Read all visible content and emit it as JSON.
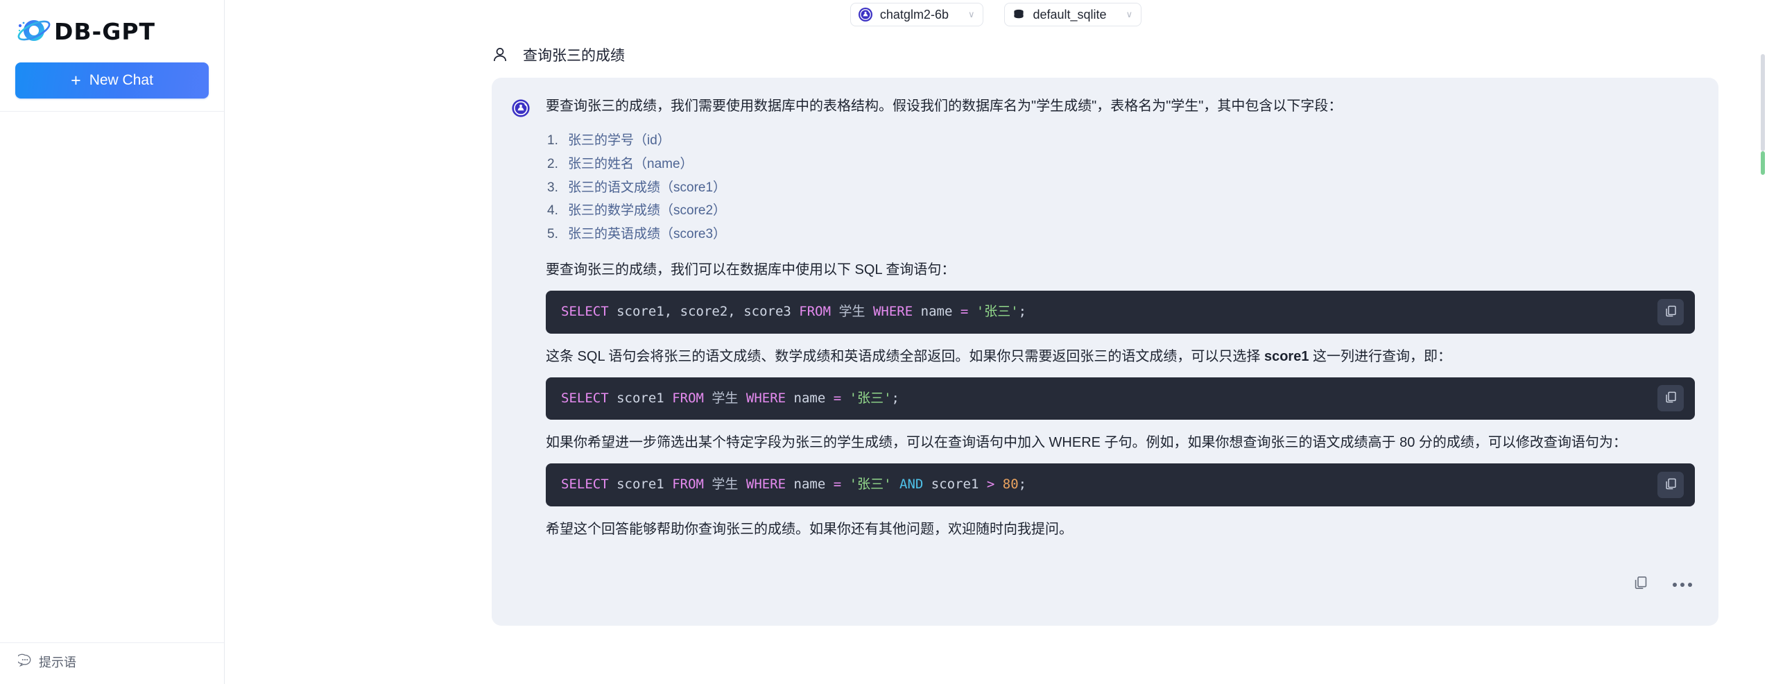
{
  "sidebar": {
    "brand_name": "DB-GPT",
    "brand_logo_icon": "planet-orbit-logo",
    "new_chat_label": "New Chat",
    "new_chat_plus": "+",
    "footer": {
      "prompt_label": "提示语",
      "prompt_icon": "chat-bubble-dots-icon"
    }
  },
  "topbar": {
    "model_selector": {
      "value": "chatglm2-6b",
      "icon": "model-badge-icon",
      "caret": "∨"
    },
    "db_selector": {
      "value": "default_sqlite",
      "icon": "database-icon",
      "caret": "∨"
    }
  },
  "conversation": {
    "user_message": {
      "icon": "user-person-icon",
      "text": "查询张三的成绩"
    },
    "assistant_message": {
      "avatar_icon": "assistant-badge-icon",
      "lead_paragraph": "要查询张三的成绩，我们需要使用数据库中的表格结构。假设我们的数据库名为\"学生成绩\"，表格名为\"学生\"，其中包含以下字段：",
      "fields": [
        "张三的学号（id）",
        "张三的姓名（name）",
        "张三的语文成绩（score1）",
        "张三的数学成绩（score2）",
        "张三的英语成绩（score3）"
      ],
      "paragraph_2": "要查询张三的成绩，我们可以在数据库中使用以下 SQL 查询语句：",
      "code_1": {
        "language": "sql",
        "text": "SELECT score1, score2, score3 FROM 学生 WHERE name = '张三';",
        "copy_icon": "copy-icon"
      },
      "paragraph_3_before": "这条 SQL 语句会将张三的语文成绩、数学成绩和英语成绩全部返回。如果你只需要返回张三的语文成绩，可以只选择 ",
      "paragraph_3_bold": "score1",
      "paragraph_3_after": " 这一列进行查询，即：",
      "code_2": {
        "language": "sql",
        "text": "SELECT score1 FROM 学生 WHERE name = '张三';",
        "copy_icon": "copy-icon"
      },
      "paragraph_4": "如果你希望进一步筛选出某个特定字段为张三的学生成绩，可以在查询语句中加入 WHERE 子句。例如，如果你想查询张三的语文成绩高于 80 分的成绩，可以修改查询语句为：",
      "code_3": {
        "language": "sql",
        "text": "SELECT score1 FROM 学生 WHERE name = '张三' AND score1 > 80;",
        "copy_icon": "copy-icon"
      },
      "paragraph_5": "希望这个回答能够帮助你查询张三的成绩。如果你还有其他问题，欢迎随时向我提问。",
      "actions": {
        "copy_icon": "copy-icon",
        "more_icon": "more-horizontal-icon"
      }
    }
  },
  "colors": {
    "brand_blue": "#1b8cf5",
    "assistant_card_bg": "#eef1f7",
    "code_bg": "#262b38",
    "list_text": "#4d6493",
    "keyword": "#e68bf0",
    "keyword_alt": "#4fc1e8",
    "string": "#93d98b",
    "number": "#e9a25f",
    "scrollbar_green": "#7ed096"
  }
}
